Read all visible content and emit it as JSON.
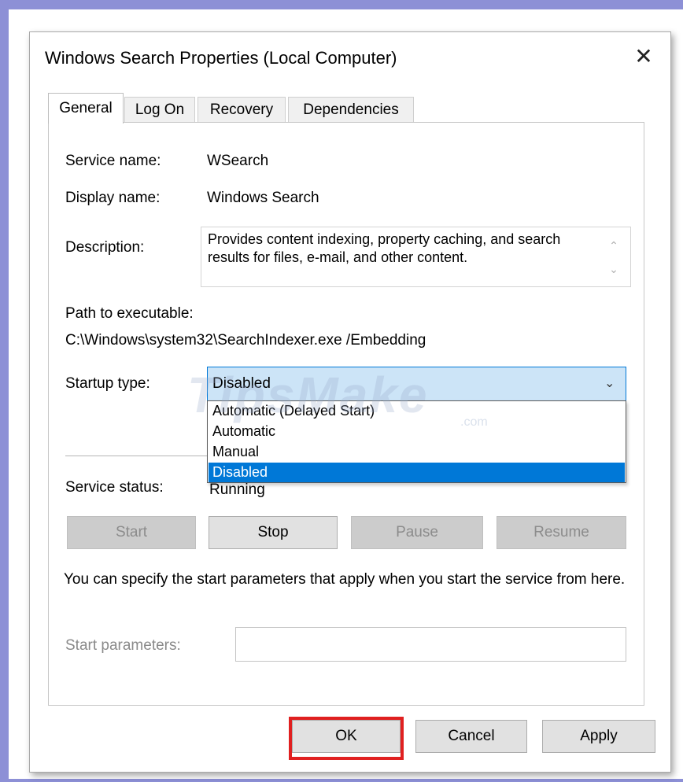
{
  "window": {
    "title": "Windows Search Properties (Local Computer)",
    "close_glyph": "✕"
  },
  "tabs": [
    {
      "label": "General"
    },
    {
      "label": "Log On"
    },
    {
      "label": "Recovery"
    },
    {
      "label": "Dependencies"
    }
  ],
  "general": {
    "service_name_label": "Service name:",
    "service_name_value": "WSearch",
    "display_name_label": "Display name:",
    "display_name_value": "Windows Search",
    "description_label": "Description:",
    "description_value": "Provides content indexing, property caching, and search results for files, e-mail, and other content.",
    "path_label": "Path to executable:",
    "path_value": "C:\\Windows\\system32\\SearchIndexer.exe /Embedding",
    "startup_type_label": "Startup type:",
    "startup_type_value": "Disabled",
    "startup_options": [
      "Automatic (Delayed Start)",
      "Automatic",
      "Manual",
      "Disabled"
    ],
    "service_status_label": "Service status:",
    "service_status_value": "Running",
    "service_buttons": {
      "start": "Start",
      "stop": "Stop",
      "pause": "Pause",
      "resume": "Resume"
    },
    "hint_text": "You can specify the start parameters that apply when you start the service from here.",
    "start_parameters_label": "Start parameters:",
    "start_parameters_value": ""
  },
  "footer": {
    "ok": "OK",
    "cancel": "Cancel",
    "apply": "Apply"
  },
  "watermark": {
    "main": "TipsMake",
    "suffix": ".com"
  },
  "colors": {
    "frame": "#8d90d6",
    "selection": "#0078d7",
    "combo_bg": "#cce4f7",
    "highlight": "#e02020"
  }
}
